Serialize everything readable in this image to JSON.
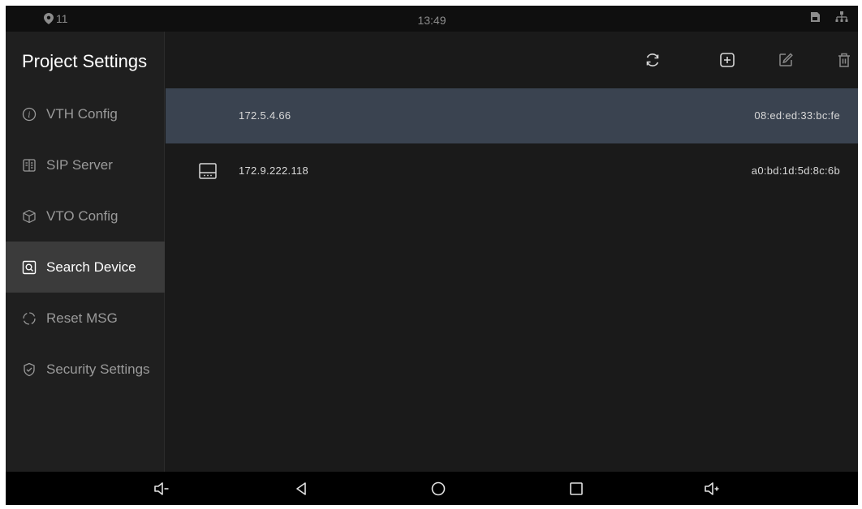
{
  "status_bar": {
    "notification_count": "11",
    "time": "13:49",
    "icons": [
      "location-pin-icon",
      "sd-card-icon",
      "network-icon"
    ]
  },
  "sidebar": {
    "title": "Project Settings",
    "items": [
      {
        "label": "VTH Config",
        "icon": "info-circle-icon",
        "active": false
      },
      {
        "label": "SIP Server",
        "icon": "server-icon",
        "active": false
      },
      {
        "label": "VTO Config",
        "icon": "cube-icon",
        "active": false
      },
      {
        "label": "Search Device",
        "icon": "search-box-icon",
        "active": true
      },
      {
        "label": "Reset MSG",
        "icon": "reset-circle-icon",
        "active": false
      },
      {
        "label": "Security Settings",
        "icon": "shield-check-icon",
        "active": false
      }
    ]
  },
  "toolbar": {
    "icons": [
      "refresh-icon",
      "add-icon",
      "edit-icon",
      "delete-icon"
    ]
  },
  "devices": [
    {
      "ip": "172.5.4.66",
      "mac": "08:ed:ed:33:bc:fe",
      "selected": true,
      "icon": ""
    },
    {
      "ip": "172.9.222.118",
      "mac": "a0:bd:1d:5d:8c:6b",
      "selected": false,
      "icon": "device-monitor-icon"
    }
  ],
  "navigation_bar": {
    "icons": [
      "volume-down-icon",
      "back-icon",
      "home-icon",
      "recents-icon",
      "volume-up-icon"
    ]
  },
  "colors": {
    "background": "#1a1a1a",
    "sidebar_active": "#3b3b3b",
    "row_selected": "#3a4350",
    "text_primary": "#ffffff",
    "text_secondary": "#9a9a9a"
  }
}
